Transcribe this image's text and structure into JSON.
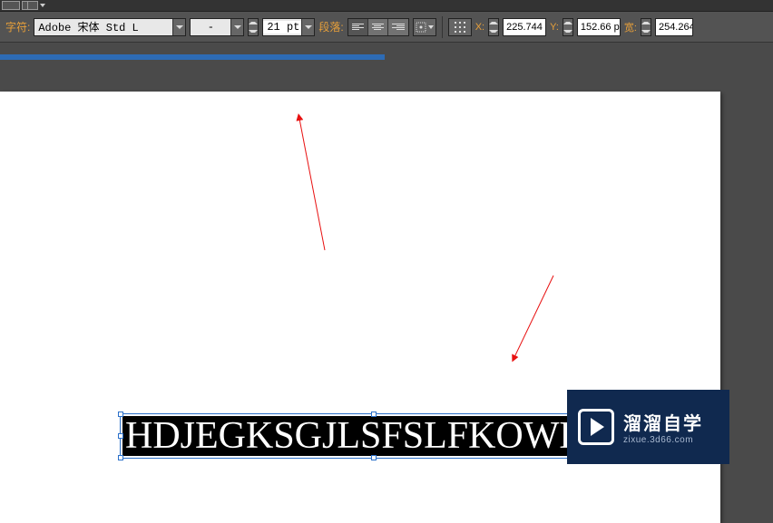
{
  "toolbar": {
    "char_label": "字符:",
    "font_name": "Adobe 宋体 Std L",
    "font_style": "-",
    "font_size": "21 pt",
    "para_label": "段落:"
  },
  "transform": {
    "x_label": "X:",
    "x_value": "225.744",
    "y_label": "Y:",
    "y_value": "152.66 p",
    "w_label": "宽:",
    "w_value": "254.264"
  },
  "canvas": {
    "text_content": "HDJEGKSGJLSFSLFKOWEJE"
  },
  "watermark": {
    "title": "溜溜自学",
    "url": "zixue.3d66.com"
  }
}
